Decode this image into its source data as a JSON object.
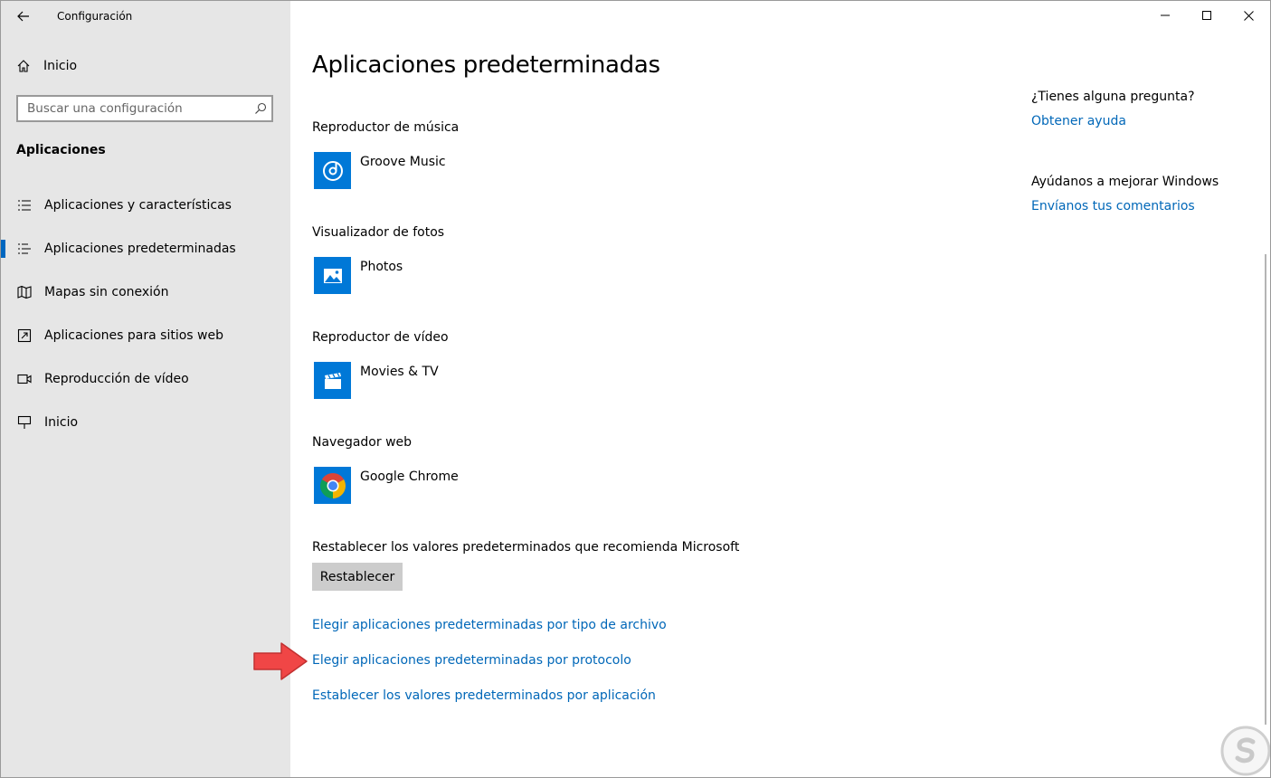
{
  "window": {
    "title": "Configuración"
  },
  "colors": {
    "accent": "#0078d7",
    "link": "#0067b8",
    "sidebar_bg": "#e6e6e6",
    "arrow": "#f04646"
  },
  "sidebar": {
    "home_label": "Inicio",
    "search_placeholder": "Buscar una configuración",
    "section_title": "Aplicaciones",
    "items": [
      {
        "label": "Aplicaciones y características",
        "icon": "apps-features-icon"
      },
      {
        "label": "Aplicaciones predeterminadas",
        "icon": "default-apps-icon",
        "active": true
      },
      {
        "label": "Mapas sin conexión",
        "icon": "offline-maps-icon"
      },
      {
        "label": "Aplicaciones para sitios web",
        "icon": "apps-websites-icon"
      },
      {
        "label": "Reproducción de vídeo",
        "icon": "video-playback-icon"
      },
      {
        "label": "Inicio",
        "icon": "startup-icon"
      }
    ]
  },
  "main": {
    "title": "Aplicaciones predeterminadas",
    "groups": [
      {
        "label": "Reproductor de música",
        "app": "Groove Music",
        "icon": "groove-music-icon"
      },
      {
        "label": "Visualizador de fotos",
        "app": "Photos",
        "icon": "photos-icon"
      },
      {
        "label": "Reproductor de vídeo",
        "app": "Movies & TV",
        "icon": "movies-tv-icon"
      },
      {
        "label": "Navegador web",
        "app": "Google Chrome",
        "icon": "chrome-icon"
      }
    ],
    "reset_text": "Restablecer los valores predeterminados que recomienda Microsoft",
    "reset_button": "Restablecer",
    "links": [
      "Elegir aplicaciones predeterminadas por tipo de archivo",
      "Elegir aplicaciones predeterminadas por protocolo",
      "Establecer los valores predeterminados por aplicación"
    ]
  },
  "aside": {
    "question": "¿Tienes alguna pregunta?",
    "help_link": "Obtener ayuda",
    "improve_text": "Ayúdanos a mejorar Windows",
    "feedback_link": "Envíanos tus comentarios"
  }
}
